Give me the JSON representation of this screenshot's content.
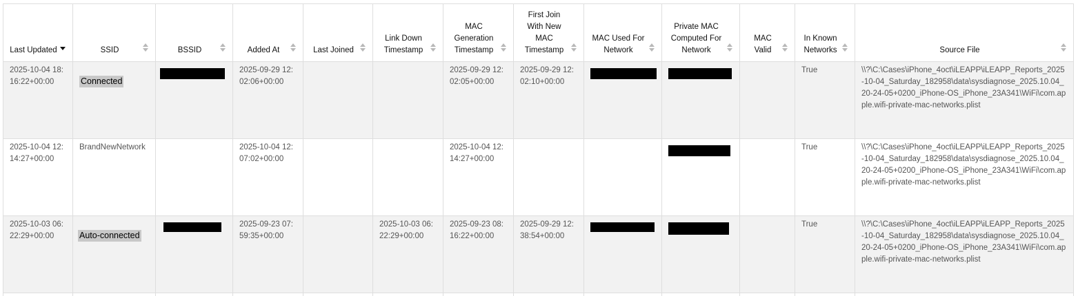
{
  "table": {
    "headers": [
      "Last Updated",
      "SSID",
      "BSSID",
      "Added At",
      "Last Joined",
      "Link Down Timestamp",
      "MAC Generation Timestamp",
      "First Join With New MAC Timestamp",
      "MAC Used For Network",
      "Private MAC Computed For Network",
      "MAC Valid",
      "In Known Networks",
      "Source File"
    ],
    "rows": [
      {
        "last_updated": "2025-10-04 18:16:22+00:00",
        "ssid": "Connected",
        "bssid": "",
        "added_at": "2025-09-29 12:02:06+00:00",
        "last_joined": "",
        "link_down": "",
        "mac_generation": "2025-09-29 12:02:05+00:00",
        "first_join_new_mac": "2025-09-29 12:02:10+00:00",
        "mac_used": "",
        "private_mac": "",
        "mac_valid": "",
        "in_known": "True",
        "source_file": "\\\\?\\C:\\Cases\\iPhone_4oct\\iLEAPP\\iLEAPP_Reports_2025-10-04_Saturday_182958\\data\\sysdiagnose_2025.10.04_20-24-05+0200_iPhone-OS_iPhone_23A341\\WiFi\\com.apple.wifi-private-mac-networks.plist"
      },
      {
        "last_updated": "2025-10-04 12:14:27+00:00",
        "ssid": "BrandNewNetwork",
        "bssid": "",
        "added_at": "2025-10-04 12:07:02+00:00",
        "last_joined": "",
        "link_down": "",
        "mac_generation": "2025-10-04 12:14:27+00:00",
        "first_join_new_mac": "",
        "mac_used": "",
        "private_mac": "",
        "mac_valid": "",
        "in_known": "True",
        "source_file": "\\\\?\\C:\\Cases\\iPhone_4oct\\iLEAPP\\iLEAPP_Reports_2025-10-04_Saturday_182958\\data\\sysdiagnose_2025.10.04_20-24-05+0200_iPhone-OS_iPhone_23A341\\WiFi\\com.apple.wifi-private-mac-networks.plist"
      },
      {
        "last_updated": "2025-10-03 06:22:29+00:00",
        "ssid": "Auto-connected",
        "bssid": "",
        "added_at": "2025-09-23 07:59:35+00:00",
        "last_joined": "",
        "link_down": "2025-10-03 06:22:29+00:00",
        "mac_generation": "2025-09-23 08:16:22+00:00",
        "first_join_new_mac": "2025-09-29 12:38:54+00:00",
        "mac_used": "",
        "private_mac": "",
        "mac_valid": "",
        "in_known": "True",
        "source_file": "\\\\?\\C:\\Cases\\iPhone_4oct\\iLEAPP\\iLEAPP_Reports_2025-10-04_Saturday_182958\\data\\sysdiagnose_2025.10.04_20-24-05+0200_iPhone-OS_iPhone_23A341\\WiFi\\com.apple.wifi-private-mac-networks.plist"
      }
    ]
  }
}
